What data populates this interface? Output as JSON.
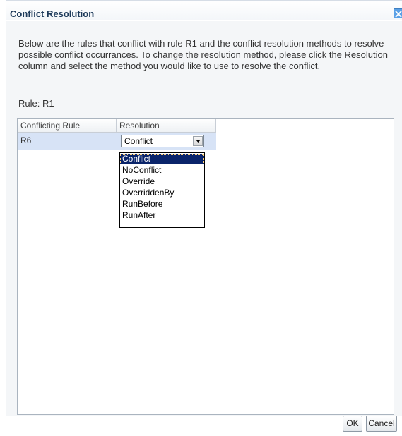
{
  "dialog": {
    "title": "Conflict Resolution",
    "description": "Below are the rules that conflict with rule R1 and the conflict resolution methods to resolve possible conflict occurrances. To change the resolution method, please click the Resolution column and select the method you would like to use to resolve the conflict.",
    "rule_label": "Rule: R1"
  },
  "table": {
    "headers": [
      "Conflicting Rule",
      "Resolution"
    ],
    "rows": [
      {
        "rule": "R6",
        "resolution": "Conflict"
      }
    ]
  },
  "dropdown": {
    "options": [
      "Conflict",
      "NoConflict",
      "Override",
      "OverriddenBy",
      "RunBefore",
      "RunAfter"
    ],
    "selected": "Conflict"
  },
  "buttons": {
    "ok": "OK",
    "cancel": "Cancel"
  },
  "colors": {
    "selected_row": "#d7e3f6",
    "dropdown_highlight": "#0a246a",
    "title": "#1d3a5a"
  },
  "icons": {
    "close": "close-icon",
    "dropdown_arrow": "chevron-down-icon"
  }
}
